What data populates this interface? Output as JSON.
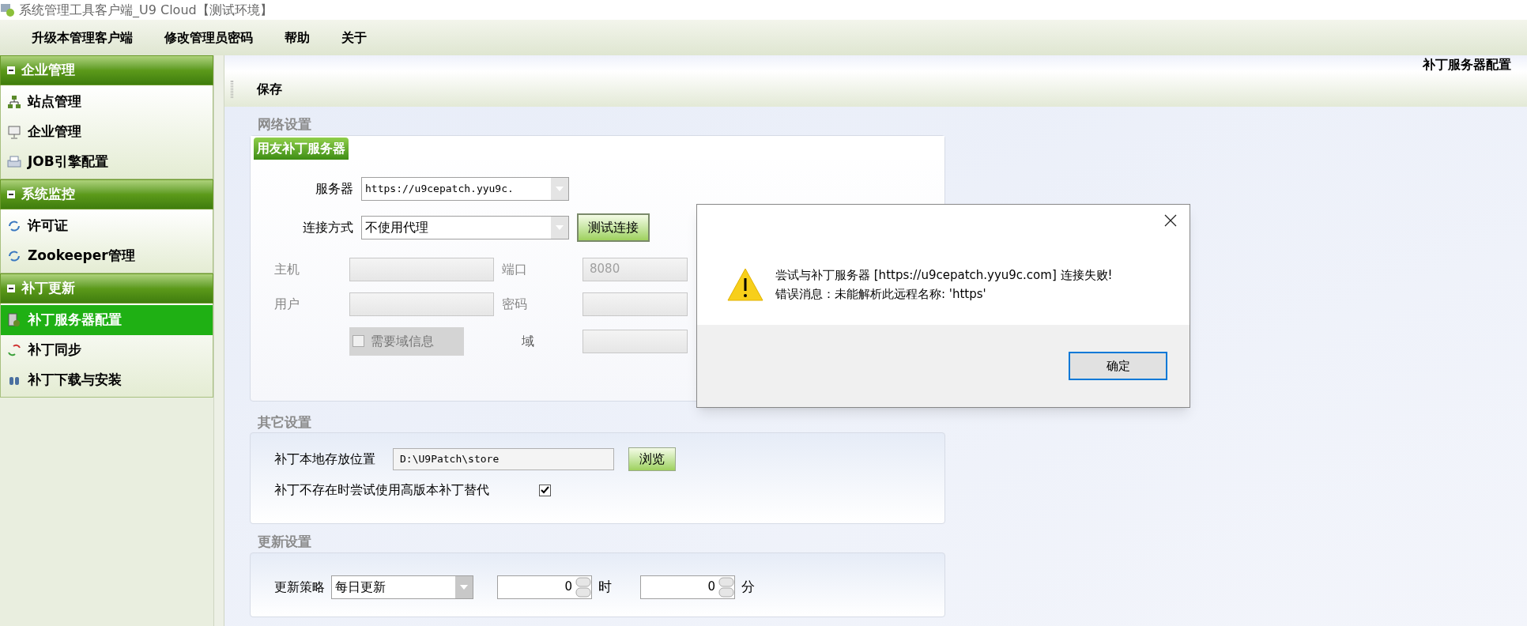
{
  "window": {
    "title": "系统管理工具客户端_U9 Cloud【测试环境】"
  },
  "menu": [
    "升级本管理客户端",
    "修改管理员密码",
    "帮助",
    "关于"
  ],
  "sidebar": {
    "groups": [
      {
        "title": "企业管理",
        "expanded": true,
        "items": [
          {
            "label": "站点管理",
            "selected": false
          },
          {
            "label": "企业管理",
            "selected": false
          },
          {
            "label": "JOB引擎配置",
            "selected": false
          }
        ]
      },
      {
        "title": "系统监控",
        "expanded": true,
        "items": [
          {
            "label": "许可证",
            "selected": false
          },
          {
            "label": "Zookeeper管理",
            "selected": false
          }
        ]
      },
      {
        "title": "补丁更新",
        "expanded": true,
        "items": [
          {
            "label": "补丁服务器配置",
            "selected": true
          },
          {
            "label": "补丁同步",
            "selected": false
          },
          {
            "label": "补丁下载与安装",
            "selected": false
          }
        ]
      }
    ]
  },
  "page_title": "补丁服务器配置",
  "toolbar": [
    "保存"
  ],
  "network_settings": {
    "title": "网络设置",
    "tab": {
      "label": "用友补丁服务器",
      "selected": true
    },
    "server": {
      "label": "服务器",
      "value": "https://u9cepatch.yyu9c."
    },
    "connection": {
      "label": "连接方式",
      "value": "不使用代理"
    },
    "test_button": "测试连接",
    "host": {
      "label": "主机",
      "disabled": true
    },
    "port": {
      "label": "端口",
      "value": "8080",
      "disabled": true
    },
    "user": {
      "label": "用户",
      "disabled": true
    },
    "password": {
      "label": "密码",
      "disabled": true
    },
    "domain_checkbox": {
      "label": "需要域信息",
      "checked": false,
      "disabled": true
    },
    "domain": {
      "label": "域",
      "disabled": true
    }
  },
  "other_settings": {
    "title": "其它设置",
    "path": {
      "label": "补丁本地存放位置",
      "value": "D:\\U9Patch\\store"
    },
    "browse_button": "浏览",
    "fallback": {
      "label": "补丁不存在时尝试使用高版本补丁替代",
      "checked": true
    }
  },
  "update_settings": {
    "title": "更新设置",
    "strategy": {
      "label": "更新策略",
      "value": "每日更新"
    },
    "hour": {
      "value": "0",
      "unit": "时"
    },
    "minute": {
      "value": "0",
      "unit": "分"
    }
  },
  "dialog": {
    "lines": [
      "尝试与补丁服务器 [https://u9cepatch.yyu9c.com] 连接失败!",
      "错误消息：未能解析此远程名称: 'https'"
    ],
    "ok_button": "确定"
  }
}
